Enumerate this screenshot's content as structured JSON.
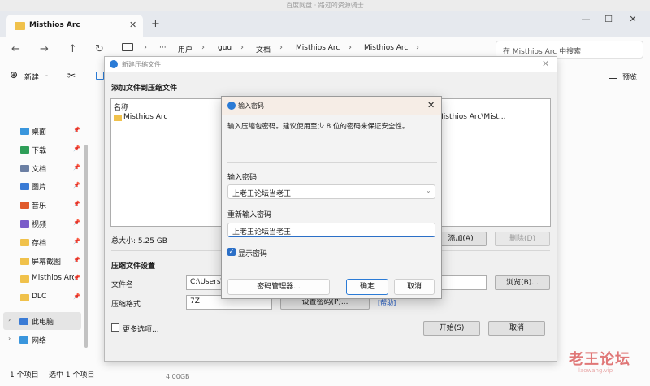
{
  "top_strip": "百度网盘 · 路过的资源骑士",
  "tab": {
    "label": "Misthios Arc"
  },
  "window_controls": {
    "minimize": "—",
    "maximize": "☐",
    "close": "✕"
  },
  "breadcrumb": [
    "用户",
    "guu",
    "文档",
    "Misthios Arc",
    "Misthios Arc"
  ],
  "search_placeholder": "在 Misthios Arc 中搜索",
  "toolbar": {
    "new_label": "新建",
    "preview_label": "预览"
  },
  "sidebar": {
    "items": [
      {
        "label": "桌面",
        "icon": "desktop-icon",
        "color": "#3a96dd"
      },
      {
        "label": "下载",
        "icon": "download-icon",
        "color": "#2e9e58"
      },
      {
        "label": "文档",
        "icon": "documents-icon",
        "color": "#6b7fa3"
      },
      {
        "label": "图片",
        "icon": "pictures-icon",
        "color": "#3a7bd5"
      },
      {
        "label": "音乐",
        "icon": "music-icon",
        "color": "#e0592a"
      },
      {
        "label": "视频",
        "icon": "videos-icon",
        "color": "#7a5cc9"
      },
      {
        "label": "存档",
        "icon": "folder-icon",
        "color": "#f0c14b"
      },
      {
        "label": "屏幕截图",
        "icon": "folder-icon",
        "color": "#f0c14b"
      },
      {
        "label": "Misthios Arc",
        "icon": "folder-icon",
        "color": "#f0c14b"
      },
      {
        "label": "DLC",
        "icon": "folder-icon",
        "color": "#f0c14b"
      }
    ],
    "this_pc": "此电脑",
    "network": "网络"
  },
  "statusbar": {
    "count": "1 个项目",
    "selected": "选中 1 个项目",
    "size_hint": "4.00GB"
  },
  "watermark": {
    "text": "老王论坛",
    "sub": "laowang.vip"
  },
  "archive_dialog": {
    "title": "新建压缩文件",
    "section_add": "添加文件到压缩文件",
    "col_name": "名称",
    "file_item": "Misthios Arc",
    "path_item": "Misthios Arc\\Mist...",
    "total_size": "总大小: 5.25 GB",
    "add_btn": "添加(A)",
    "delete_btn": "删除(D)",
    "section_settings": "压缩文件设置",
    "filename_label": "文件名",
    "filename_value": "C:\\Users\\",
    "browse_btn": "浏览(B)...",
    "format_label": "压缩格式",
    "format_value": "7Z",
    "set_password_btn": "设置密码(P)...",
    "help_link": "[帮助]",
    "more_options": "更多选项...",
    "start_btn": "开始(S)",
    "cancel_btn": "取消"
  },
  "password_dialog": {
    "title": "输入密码",
    "description": "输入压缩包密码。建议使用至少 8 位的密码来保证安全性。",
    "password_label": "输入密码",
    "password_value": "上老王论坛当老王",
    "confirm_label": "重新输入密码",
    "confirm_value": "上老王论坛当老王",
    "show_password": "显示密码",
    "manager_btn": "密码管理器...",
    "ok_btn": "确定",
    "cancel_btn": "取消"
  }
}
